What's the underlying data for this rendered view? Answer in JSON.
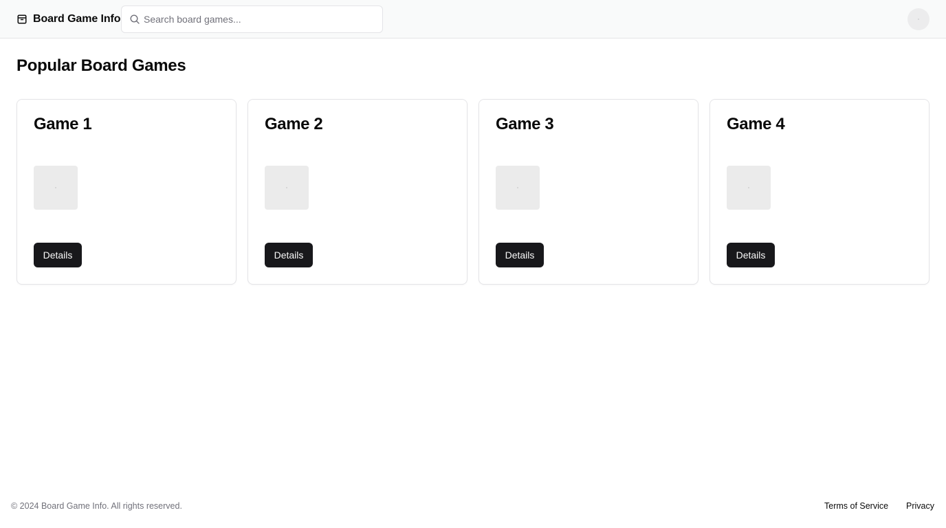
{
  "header": {
    "brand_name": "Board Game Info",
    "brand_icon": "package-icon",
    "search": {
      "icon": "search-icon",
      "placeholder": "Search board games...",
      "value": ""
    },
    "avatar_icon": "user-avatar"
  },
  "main": {
    "title": "Popular Board Games",
    "games": [
      {
        "title": "Game 1",
        "button_label": "Details"
      },
      {
        "title": "Game 2",
        "button_label": "Details"
      },
      {
        "title": "Game 3",
        "button_label": "Details"
      },
      {
        "title": "Game 4",
        "button_label": "Details"
      }
    ]
  },
  "footer": {
    "copyright": "© 2024 Board Game Info. All rights reserved.",
    "links": [
      {
        "label": "Terms of Service"
      },
      {
        "label": "Privacy"
      }
    ]
  },
  "colors": {
    "header_bg": "#f9fafa",
    "primary_button": "#18181b",
    "border": "#e4e4e7",
    "muted_text": "#71717a"
  }
}
